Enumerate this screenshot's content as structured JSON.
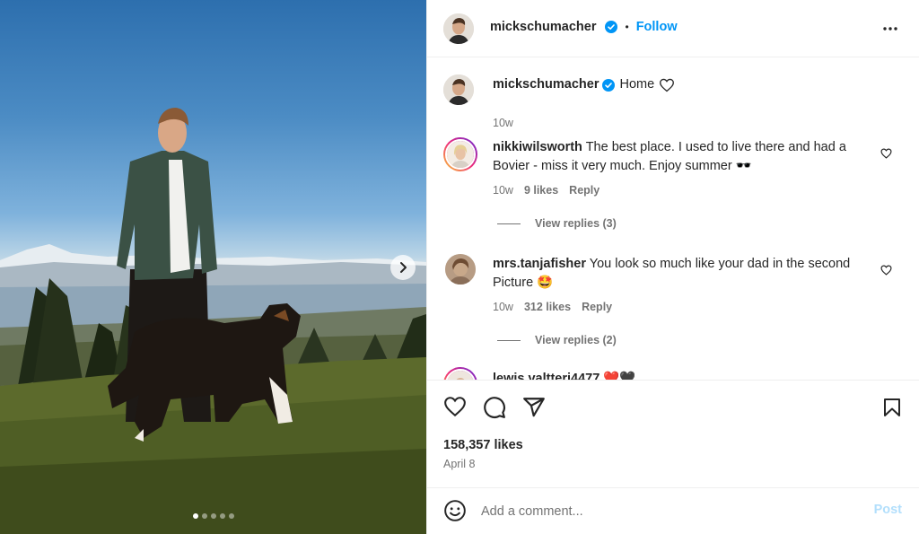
{
  "post": {
    "author": "mickschumacher",
    "follow_label": "Follow",
    "separator": "•",
    "caption": {
      "username": "mickschumacher",
      "text": "Home",
      "time": "10w"
    },
    "carousel": {
      "slide_count": 5,
      "active_index": 0
    }
  },
  "comments": [
    {
      "username": "nikkiwilsworth",
      "text": "The best place. I used to live there and had a",
      "text_line2": "Bovier - miss it very much. Enjoy summer 🕶️",
      "time": "10w",
      "likes": "9 likes",
      "reply_label": "Reply",
      "view_replies": "View replies (3)"
    },
    {
      "username": "mrs.tanjafisher",
      "text": "You look so much like your dad in the second",
      "text_line2": "Picture 🤩",
      "time": "10w",
      "likes": "312 likes",
      "reply_label": "Reply",
      "view_replies": "View replies (2)"
    },
    {
      "username": "lewis.valtteri4477",
      "text": "❤️🖤"
    }
  ],
  "footer": {
    "likes_count": "158,357 likes",
    "date": "April 8",
    "comment_placeholder": "Add a comment...",
    "post_label": "Post"
  },
  "icons": {
    "verified": "verified-badge-icon",
    "more": "more-options-icon",
    "like": "heart-icon",
    "comment": "comment-bubble-icon",
    "share": "paper-plane-icon",
    "save": "bookmark-icon",
    "emoji": "emoji-smile-icon",
    "next": "chevron-right-icon"
  },
  "colors": {
    "accent": "#0095f6",
    "verified": "#0095f6",
    "post_disabled": "#b2dffc",
    "secondary_text": "#737373",
    "primary_text": "#262626"
  }
}
